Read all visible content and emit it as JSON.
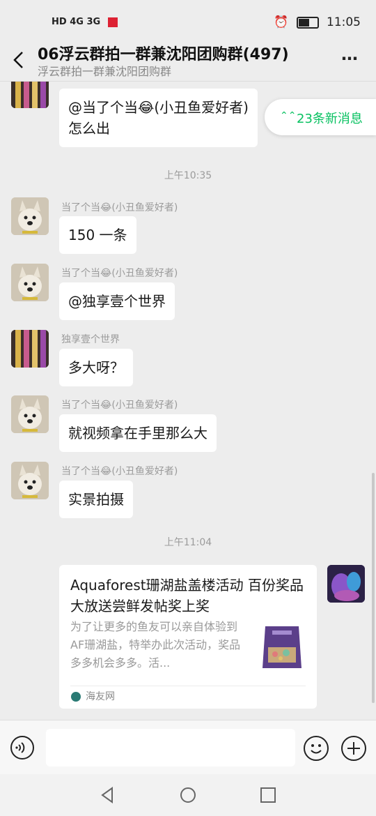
{
  "status": {
    "left_icons": "HD 4G 3G",
    "time": "11:05"
  },
  "header": {
    "title": "06浮云群拍一群兼沈阳团购群(497)",
    "subtitle": "浮云群拍一群兼沈阳团购群",
    "more": "⋯"
  },
  "new_messages": {
    "label": "23条新消息",
    "icon": "double-chevron-up-icon",
    "color": "#07c160"
  },
  "messages": [
    {
      "type": "text",
      "lines": [
        "@当了个当😂(小丑鱼爱好者)",
        "怎么出"
      ]
    },
    {
      "type": "time",
      "text": "上午10:35"
    },
    {
      "type": "text",
      "sender": "当了个当😂(小丑鱼爱好者)",
      "text": "150 一条"
    },
    {
      "type": "text",
      "sender": "当了个当😂(小丑鱼爱好者)",
      "text": "@独享壹个世界"
    },
    {
      "type": "text",
      "sender": "独享壹个世界",
      "text": "多大呀？"
    },
    {
      "type": "text",
      "sender": "当了个当😂(小丑鱼爱好者)",
      "text": "就视频拿在手里那么大"
    },
    {
      "type": "text",
      "sender": "当了个当😂(小丑鱼爱好者)",
      "text": "实景拍摄"
    },
    {
      "type": "time",
      "text": "上午11:04"
    }
  ],
  "link_card": {
    "title": "Aquaforest珊湖盐盖楼活动 百份奖品大放送尝鲜发帖奖上奖",
    "description": "为了让更多的鱼友可以亲自体验到AF珊湖盐，特举办此次活动，奖品多多机会多多。活...",
    "source": "海友网"
  },
  "input": {
    "placeholder": ""
  }
}
